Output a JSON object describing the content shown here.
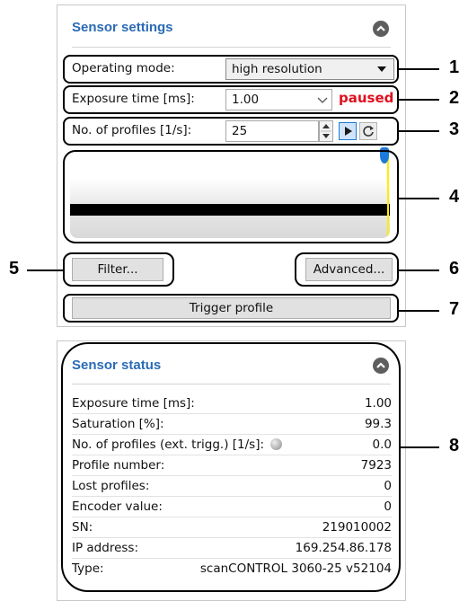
{
  "sensor_settings": {
    "title": "Sensor settings",
    "operating_mode_label": "Operating mode:",
    "operating_mode_value": "high resolution",
    "exposure_label": "Exposure time [ms]:",
    "exposure_value": "1.00",
    "status_text": "paused",
    "profiles_label": "No. of profiles [1/s]:",
    "profiles_value": "25",
    "filter_button": "Filter...",
    "advanced_button": "Advanced...",
    "trigger_button": "Trigger profile"
  },
  "sensor_status": {
    "title": "Sensor status",
    "rows": [
      {
        "label": "Exposure time [ms]:",
        "value": "1.00"
      },
      {
        "label": "Saturation [%]:",
        "value": "99.3"
      },
      {
        "label": "No. of profiles (ext. trigg.) [1/s]:",
        "value": "0.0"
      },
      {
        "label": "Profile number:",
        "value": "7923"
      },
      {
        "label": "Lost profiles:",
        "value": "0"
      },
      {
        "label": "Encoder value:",
        "value": "0"
      },
      {
        "label": "SN:",
        "value": "219010002"
      },
      {
        "label": "IP address:",
        "value": "169.254.86.178"
      },
      {
        "label": "Type:",
        "value": "scanCONTROL 3060-25 v52104"
      }
    ]
  },
  "callouts": [
    "1",
    "2",
    "3",
    "4",
    "5",
    "6",
    "7",
    "8"
  ],
  "colors": {
    "title": "#2a6bb5",
    "paused": "#e0101e",
    "accent_blue": "#1c7ad8",
    "saturation_line": "#ffee00"
  },
  "icons": [
    "chevron-up-icon",
    "dropdown-arrow-icon",
    "spinner-up-icon",
    "spinner-down-icon",
    "play-icon",
    "refresh-icon",
    "status-led-icon"
  ]
}
